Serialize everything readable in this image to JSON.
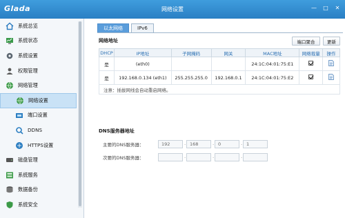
{
  "window": {
    "logo": "Glada",
    "title": "网络设置",
    "controls": {
      "minimize": "—",
      "maximize": "□",
      "close": "✕"
    }
  },
  "sidebar": {
    "items": [
      {
        "label": "系统总览",
        "icon": "home-icon",
        "level": 0
      },
      {
        "label": "系统状态",
        "icon": "monitor-icon",
        "level": 0
      },
      {
        "label": "系统设置",
        "icon": "gear-icon",
        "level": 0
      },
      {
        "label": "权限管理",
        "icon": "user-icon",
        "level": 0
      },
      {
        "label": "网络管理",
        "icon": "globe-icon",
        "level": 0
      },
      {
        "label": "网络设置",
        "icon": "globe-icon",
        "level": 1,
        "active": true
      },
      {
        "label": "端口设置",
        "icon": "port-icon",
        "level": 1
      },
      {
        "label": "DDNS",
        "icon": "ddns-icon",
        "level": 1
      },
      {
        "label": "HTTPS设置",
        "icon": "https-icon",
        "level": 1
      },
      {
        "label": "磁盘管理",
        "icon": "disk-icon",
        "level": 0
      },
      {
        "label": "系统服务",
        "icon": "service-icon",
        "level": 0
      },
      {
        "label": "数据备份",
        "icon": "backup-icon",
        "level": 0
      },
      {
        "label": "系统安全",
        "icon": "shield-icon",
        "level": 0
      }
    ]
  },
  "tabs": [
    {
      "label": "以太网络",
      "active": true
    },
    {
      "label": "IPv6",
      "active": false
    }
  ],
  "network": {
    "section_title": "网络地址",
    "buttons": {
      "port_aggregate": "端口聚合",
      "refresh": "更新"
    },
    "columns": [
      "DHCP",
      "IP地址",
      "子网掩码",
      "网关",
      "MAC地址",
      "网络裁量",
      "操作"
    ],
    "rows": [
      {
        "dhcp": "是",
        "ip": "(eth0)",
        "mask": "",
        "gateway": "",
        "mac": "24:1C:04:01:75:E1",
        "checked": true
      },
      {
        "dhcp": "是",
        "ip": "192.168.0.134 (eth1)",
        "mask": "255.255.255.0",
        "gateway": "192.168.0.1",
        "mac": "24:1C:04:01:75:E2",
        "checked": true
      }
    ],
    "note": "注意：插拔网线会自动重启网络。"
  },
  "dns": {
    "section_title": "DNS服务器地址",
    "primary_label": "主要的DNS服务器：",
    "primary": [
      "192",
      "168",
      "0",
      "1"
    ],
    "secondary_label": "次要的DNS服务器：",
    "secondary": [
      "",
      "",
      "",
      ""
    ]
  },
  "colors": {
    "titlebar": "#2a7fc4",
    "active_tab": "#5a9ddb",
    "header_text": "#2a6fb2"
  }
}
